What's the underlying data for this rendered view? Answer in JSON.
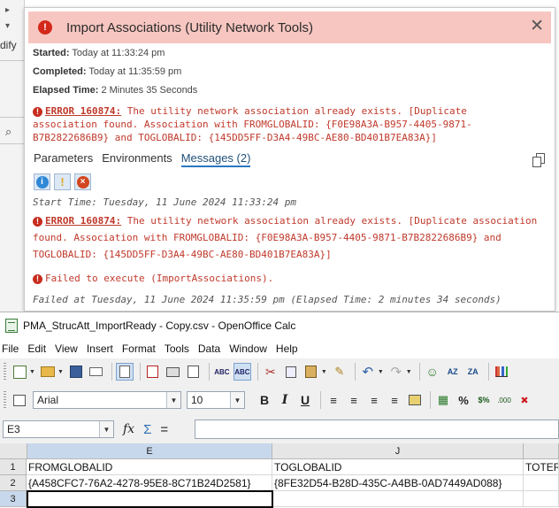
{
  "background_app": {
    "fragment_text": "dify"
  },
  "gp_dialog": {
    "title": "Import Associations (Utility Network Tools)",
    "started_label": "Started:",
    "started_value": "Today at 11:33:24 pm",
    "completed_label": "Completed:",
    "completed_value": "Today at 11:35:59 pm",
    "elapsed_label": "Elapsed Time:",
    "elapsed_value": "2 Minutes 35 Seconds",
    "error_code": "ERROR 160874:",
    "error_text": " The utility network association already exists. [Duplicate association found. Association with FROMGLOBALID: {F0E98A3A-B957-4405-9871-B7B2822686B9} and TOGLOBALID: {145DD5FF-D3A4-49BC-AE80-BD401B7EA83A}]",
    "tabs": [
      {
        "label": "Parameters"
      },
      {
        "label": "Environments"
      },
      {
        "label": "Messages (2)"
      }
    ],
    "filter_glyphs": {
      "info": "i",
      "warning": "!",
      "error": "×"
    },
    "messages": {
      "start_time": "Start Time: Tuesday, 11 June 2024 11:33:24 pm",
      "error_code": "ERROR 160874:",
      "error_text": " The utility network association already exists. [Duplicate association found. Association with FROMGLOBALID: {F0E98A3A-B957-4405-9871-B7B2822686B9} and TOGLOBALID: {145DD5FF-D3A4-49BC-AE80-BD401B7EA83A}]",
      "failed_execute": "Failed to execute (ImportAssociations).",
      "failed_at": "Failed at Tuesday, 11 June 2024 11:35:59 pm (Elapsed Time: 2 minutes 34 seconds)"
    },
    "colors": {
      "header_bg": "#f7c6c0",
      "error_text": "#c0392b"
    }
  },
  "calc": {
    "window_title": "PMA_StrucAtt_ImportReady - Copy.csv - OpenOffice Calc",
    "menu": [
      "File",
      "Edit",
      "View",
      "Insert",
      "Format",
      "Tools",
      "Data",
      "Window",
      "Help"
    ],
    "font_name": "Arial",
    "font_size": "10",
    "format_buttons": {
      "bold": "B",
      "italic": "I",
      "underline": "U",
      "percent": "%",
      "currency": "$%"
    },
    "name_box": "E3",
    "formula_glyphs": {
      "function_wizard": "fx",
      "sum": "Σ",
      "equals": "="
    },
    "columns": [
      {
        "label": "E"
      },
      {
        "label": "J"
      }
    ],
    "rows": [
      {
        "label": "1"
      },
      {
        "label": "2"
      },
      {
        "label": "3"
      }
    ],
    "cells": {
      "E1": "FROMGLOBALID",
      "J1": "TOGLOBALID",
      "K1": "TOTER",
      "E2": "{A458CFC7-76A2-4278-95E8-8C71B24D2581}",
      "J2": "{8FE32D54-B28D-435C-A4BB-0AD7449AD088}",
      "E3": ""
    }
  }
}
